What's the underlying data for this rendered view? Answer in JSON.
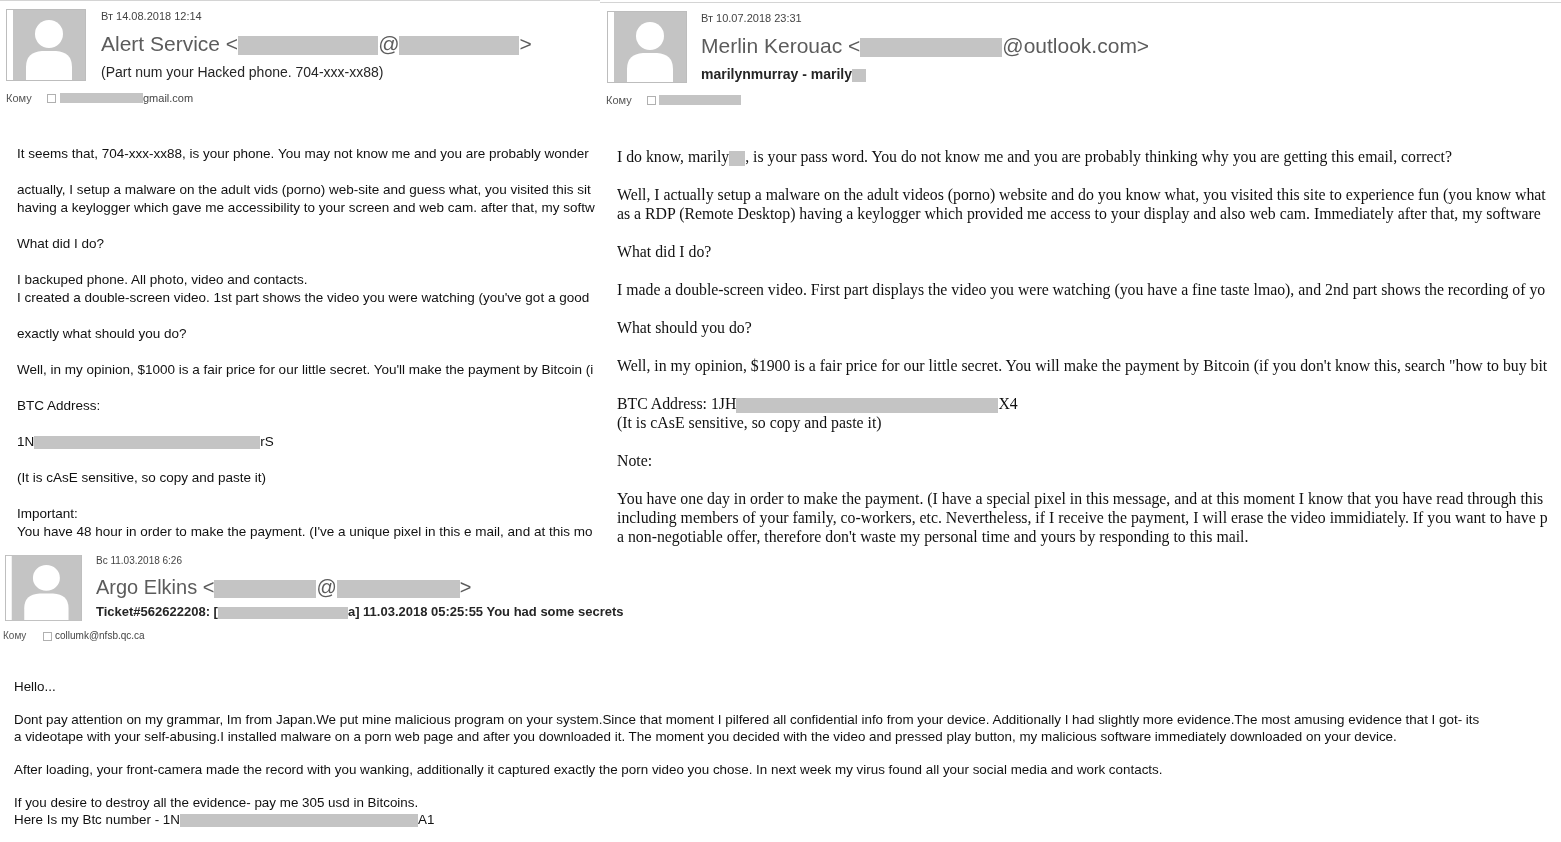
{
  "emails": [
    {
      "date": "Вт 14.08.2018 12:14",
      "sender": [
        {
          "kind": "text",
          "text": "Alert Service <"
        },
        {
          "kind": "redacted"
        },
        {
          "kind": "text",
          "text": "@"
        },
        {
          "kind": "redacted"
        },
        {
          "kind": "text",
          "text": ">"
        }
      ],
      "subject": [
        {
          "kind": "text",
          "text": "(Part num your Hacked phone. 704-xxx-xx88)"
        }
      ],
      "to_label": "Кому",
      "to": [
        {
          "kind": "redacted"
        },
        {
          "kind": "text",
          "text": "gmail.com"
        }
      ],
      "body": [
        [
          "It seems that, 704-xxx-xx88, is your phone. You may not know me and you are probably wonder"
        ],
        [
          "actually, I setup a malware on the adult vids (porno) web-site and guess what, you visited this sit",
          "having a keylogger which gave me accessibility to your screen and web cam. after that, my softw"
        ],
        [
          "What did I do?"
        ],
        [
          "I backuped phone. All photo, video and contacts.",
          "I created a double-screen video. 1st part shows the video you were watching (you've got a good"
        ],
        [
          "exactly what should you do?"
        ],
        [
          "Well, in my opinion, $1000 is a fair price for our little secret. You'll make the payment by Bitcoin (i"
        ],
        [
          "BTC Address:"
        ],
        [
          [
            {
              "kind": "text",
              "text": "1N"
            },
            {
              "kind": "redacted"
            },
            {
              "kind": "text",
              "text": "rS"
            }
          ]
        ],
        [
          "(It is cAsE sensitive, so copy and paste it)"
        ],
        [
          "Important:",
          "You have 48 hour in order to make the payment. (I've a unique pixel in this e mail, and at this mo"
        ]
      ]
    },
    {
      "date": "Вт 10.07.2018 23:31",
      "sender": [
        {
          "kind": "text",
          "text": "Merlin Kerouac <"
        },
        {
          "kind": "redacted"
        },
        {
          "kind": "text",
          "text": "@outlook.com>"
        }
      ],
      "subject": [
        {
          "kind": "text",
          "text": "marilynmurray - marily"
        },
        {
          "kind": "redacted"
        }
      ],
      "to_label": "Кому",
      "to": [
        {
          "kind": "redacted"
        }
      ],
      "body": [
        [
          [
            {
              "kind": "text",
              "text": "I do know, marily"
            },
            {
              "kind": "redacted"
            },
            {
              "kind": "text",
              "text": ", is your pass word. You do not know me and you are probably thinking why you are getting this email, correct?"
            }
          ]
        ],
        [
          "Well, I actually setup a malware on the adult videos (porno) website and do you know what, you visited this site to experience fun (you know what",
          "as a RDP (Remote Desktop) having a keylogger which provided me access to your display and also web cam. Immediately after that, my software"
        ],
        [
          "What did I do?"
        ],
        [
          "I made a double-screen video. First part displays the video you were watching (you have a fine taste lmao), and 2nd part shows the recording of yo"
        ],
        [
          "What should you do?"
        ],
        [
          "Well, in my opinion, $1900 is a fair price for our little secret. You will make the payment by Bitcoin (if you don't know this, search \"how to buy bit"
        ],
        [
          [
            {
              "kind": "text",
              "text": "BTC Address: 1JH"
            },
            {
              "kind": "redacted"
            },
            {
              "kind": "text",
              "text": "X4"
            }
          ],
          "(It is cAsE sensitive, so copy and paste it)"
        ],
        [
          "Note:"
        ],
        [
          "You have one day in order to make the payment. (I have a special pixel in this message, and at this moment I know that you have read through this",
          "including members of your family, co-workers, etc. Nevertheless, if I receive the payment, I will erase the video immidiately. If you want to have p",
          "a non-negotiable offer, therefore don't waste my personal time and yours by responding to this mail."
        ]
      ]
    },
    {
      "date": "Вс 11.03.2018 6:26",
      "sender": [
        {
          "kind": "text",
          "text": "Argo Elkins <"
        },
        {
          "kind": "redacted"
        },
        {
          "kind": "text",
          "text": "@"
        },
        {
          "kind": "redacted"
        },
        {
          "kind": "text",
          "text": ">"
        }
      ],
      "subject": [
        {
          "kind": "text",
          "text": "Ticket#562622208: ["
        },
        {
          "kind": "redacted"
        },
        {
          "kind": "text",
          "text": "a] 11.03.2018 05:25:55 You had some secrets"
        }
      ],
      "to_label": "Кому",
      "to": [
        {
          "kind": "text",
          "text": "collumk@nfsb.qc.ca"
        }
      ],
      "body": [
        [
          "Hello..."
        ],
        [
          "Dont pay attention on my grammar, Im from Japan.We put mine malicious program on your system.Since that moment I pilfered all confidential info from your device. Additionally I had slightly more evidence.The most amusing evidence that I got- its",
          "a videotape with your self-abusing.I installed malware on a porn web page and after you downloaded it. The moment you decided with the video and pressed play button, my malicious software immediately downloaded on your device."
        ],
        [
          "After loading, your front-camera made the record with you wanking, additionally it captured exactly the porn video you chose. In next week my virus found all your social media and work contacts."
        ],
        [
          "If you desire to destroy all the evidence- pay me 305 usd in Bitcoins.",
          [
            {
              "kind": "text",
              "text": "Here Is my Btc number - 1N"
            },
            {
              "kind": "redacted"
            },
            {
              "kind": "text",
              "text": "A1"
            }
          ]
        ]
      ]
    }
  ]
}
